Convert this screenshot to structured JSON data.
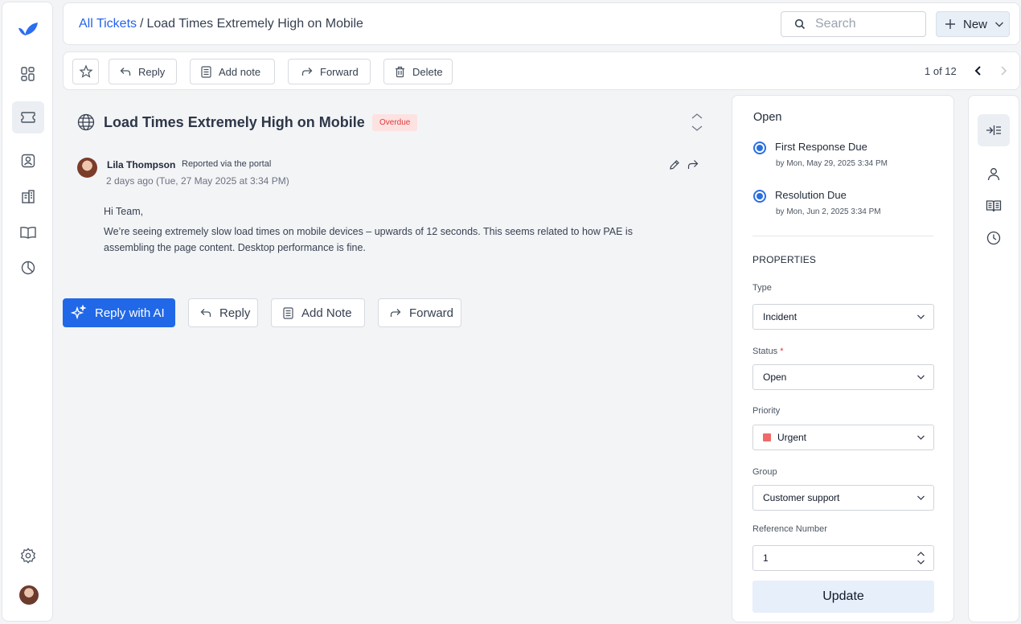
{
  "nav": {
    "items": [
      {
        "icon": "logo-icon"
      },
      {
        "icon": "dashboard-icon"
      },
      {
        "icon": "tickets-icon",
        "active": true
      },
      {
        "icon": "contacts-icon"
      },
      {
        "icon": "companies-icon"
      },
      {
        "icon": "knowledge-base-icon"
      },
      {
        "icon": "reports-icon"
      },
      {
        "icon": "settings-icon"
      }
    ]
  },
  "header": {
    "breadcrumb_link": "All Tickets",
    "breadcrumb_sep": "/",
    "breadcrumb_current": "Load Times Extremely High on Mobile",
    "search_placeholder": "Search",
    "new_label": "New"
  },
  "toolbar": {
    "reply": "Reply",
    "add_note": "Add note",
    "forward": "Forward",
    "delete": "Delete",
    "pager": "1 of 12"
  },
  "ticket": {
    "title": "Load Times Extremely High on Mobile",
    "badge": "Overdue",
    "author": "Lila Thompson",
    "via": "Reported via the portal",
    "time": "2 days ago (Tue, 27 May 2025 at 3:34 PM)",
    "greeting": "Hi Team,",
    "body": "We’re seeing extremely slow load times on mobile devices – upwards of 12 seconds. This seems related to how PAE is assembling the page content. Desktop performance is fine."
  },
  "actions": {
    "reply_ai": "Reply with AI",
    "reply": "Reply",
    "add_note": "Add Note",
    "forward": "Forward"
  },
  "properties": {
    "status_title": "Open",
    "first_response_label": "First Response Due",
    "first_response_due": "by Mon, May 29, 2025 3:34 PM",
    "resolution_label": "Resolution Due",
    "resolution_due": "by Mon, Jun 2, 2025 3:34 PM",
    "heading": "PROPERTIES",
    "type_label": "Type",
    "type_value": "Incident",
    "status_label": "Status",
    "status_required": "*",
    "status_value": "Open",
    "priority_label": "Priority",
    "priority_value": "Urgent",
    "priority_color": "#f06a6a",
    "group_label": "Group",
    "group_value": "Customer support",
    "reference_label": "Reference Number",
    "reference_value": "1",
    "update_label": "Update"
  },
  "colors": {
    "accent": "#2168e8",
    "link": "#2563eb",
    "overdue": "#e03a3a"
  }
}
